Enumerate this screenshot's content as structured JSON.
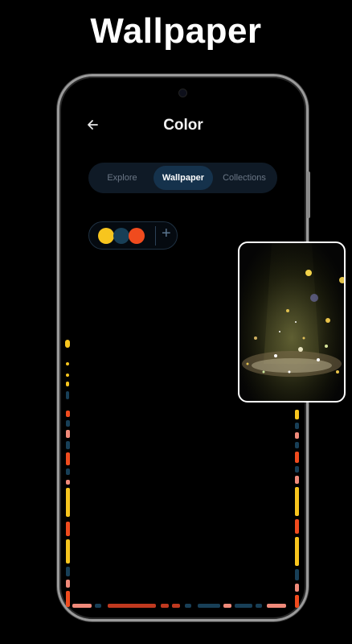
{
  "headline": "Wallpaper",
  "screen": {
    "title": "Color",
    "tabs": [
      {
        "label": "Explore",
        "active": false
      },
      {
        "label": "Wallpaper",
        "active": true
      },
      {
        "label": "Collections",
        "active": false
      }
    ],
    "palette": {
      "colors": [
        "#f7c51e",
        "#183f57",
        "#f04b1e"
      ],
      "add_label": "+"
    }
  },
  "icons": {
    "back": "arrow-left-icon",
    "add": "plus-icon"
  },
  "colors": {
    "background": "#000000",
    "tab_active_bg": "#15324c",
    "tabs_bg": "#0f1a26"
  }
}
